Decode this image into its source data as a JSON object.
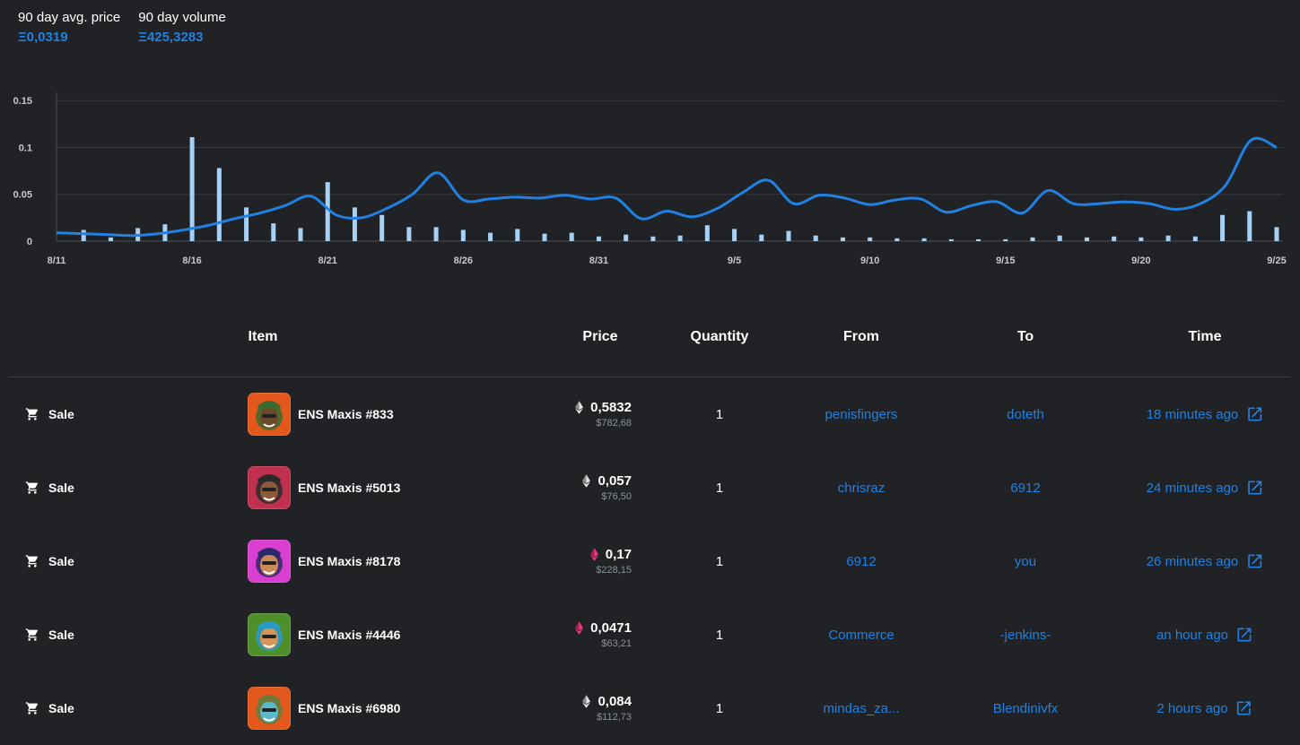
{
  "stats": [
    {
      "label": "90 day avg. price",
      "value": "Ξ0,0319"
    },
    {
      "label": "90 day volume",
      "value": "Ξ425,3283"
    }
  ],
  "colors": {
    "accent": "#2081e2",
    "bar": "#a7d0f5",
    "background": "#202225"
  },
  "chart_data": {
    "type": "bar+line",
    "y_ticks": [
      "0.15",
      "0.1",
      "0.05",
      "0"
    ],
    "ylim": [
      0,
      0.155
    ],
    "x_tick_labels": [
      "8/11",
      "8/16",
      "8/21",
      "8/26",
      "8/31",
      "9/5",
      "9/10",
      "9/15",
      "9/20",
      "9/25"
    ],
    "grid": true,
    "bar_series": {
      "name": "volume",
      "values": [
        0.012,
        0.004,
        0.014,
        0.018,
        0.111,
        0.078,
        0.036,
        0.019,
        0.014,
        0.063,
        0.036,
        0.028,
        0.015,
        0.015,
        0.012,
        0.009,
        0.013,
        0.008,
        0.009,
        0.005,
        0.007,
        0.005,
        0.006,
        0.017,
        0.013,
        0.007,
        0.011,
        0.006,
        0.004,
        0.004,
        0.003,
        0.003,
        0.002,
        0.002,
        0.002,
        0.004,
        0.006,
        0.004,
        0.005,
        0.004,
        0.006,
        0.005,
        0.028,
        0.032,
        0.015
      ]
    },
    "line_series": {
      "name": "avg price",
      "values": [
        0.009,
        0.008,
        0.007,
        0.006,
        0.008,
        0.012,
        0.017,
        0.024,
        0.03,
        0.038,
        0.048,
        0.028,
        0.025,
        0.035,
        0.05,
        0.073,
        0.044,
        0.045,
        0.047,
        0.046,
        0.049,
        0.045,
        0.046,
        0.024,
        0.032,
        0.026,
        0.035,
        0.052,
        0.065,
        0.04,
        0.049,
        0.046,
        0.039,
        0.044,
        0.045,
        0.031,
        0.038,
        0.042,
        0.03,
        0.054,
        0.04,
        0.04,
        0.042,
        0.04,
        0.034,
        0.04,
        0.06,
        0.108,
        0.1
      ]
    }
  },
  "table": {
    "headers": {
      "item": "Item",
      "price": "Price",
      "quantity": "Quantity",
      "from": "From",
      "to": "To",
      "time": "Time"
    },
    "rows": [
      {
        "event": "Sale",
        "item": "ENS Maxis #833",
        "price": "0,5832",
        "usd": "$782,68",
        "quantity": "1",
        "from": "penisfingers",
        "to": "doteth",
        "time": "18 minutes ago",
        "token": "eth",
        "thumb_bg": "#e5581b",
        "face": "#6b4a2a",
        "hair": "#3b6b2e"
      },
      {
        "event": "Sale",
        "item": "ENS Maxis #5013",
        "price": "0,057",
        "usd": "$76,50",
        "quantity": "1",
        "from": "chrisraz",
        "to": "6912",
        "time": "24 minutes ago",
        "token": "eth",
        "thumb_bg": "#c03150",
        "face": "#8a5a3a",
        "hair": "#2a2a2a"
      },
      {
        "event": "Sale",
        "item": "ENS Maxis #8178",
        "price": "0,17",
        "usd": "$228,15",
        "quantity": "1",
        "from": "6912",
        "to": "you",
        "time": "26 minutes ago",
        "token": "weth",
        "thumb_bg": "#d93fd0",
        "face": "#c98a5a",
        "hair": "#2a2a6a"
      },
      {
        "event": "Sale",
        "item": "ENS Maxis #4446",
        "price": "0,0471",
        "usd": "$63,21",
        "quantity": "1",
        "from": "Commerce",
        "to": "-jenkins-",
        "time": "an hour ago",
        "token": "weth",
        "thumb_bg": "#4f8f2a",
        "face": "#d6955a",
        "hair": "#2a9ac8"
      },
      {
        "event": "Sale",
        "item": "ENS Maxis #6980",
        "price": "0,084",
        "usd": "$112,73",
        "quantity": "1",
        "from": "mindas_za...",
        "to": "Blendinivfx",
        "time": "2 hours ago",
        "token": "eth",
        "thumb_bg": "#e5581b",
        "face": "#5ab8c8",
        "hair": "#6b7a3a"
      }
    ]
  }
}
